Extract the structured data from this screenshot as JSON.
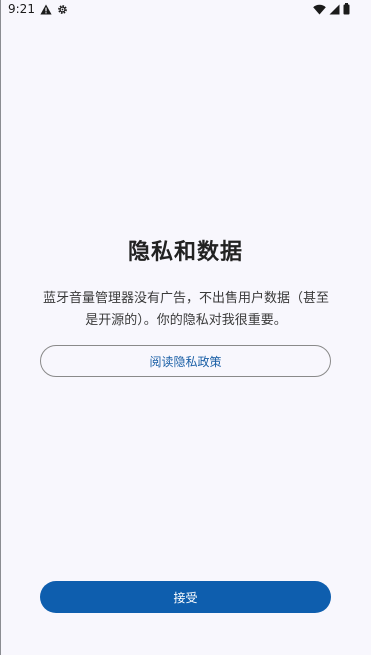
{
  "status_bar": {
    "time": "9:21",
    "left_icons": [
      "warning-icon",
      "settings-icon"
    ],
    "right_icons": [
      "wifi-icon",
      "signal-icon",
      "battery-icon"
    ]
  },
  "main": {
    "title": "隐私和数据",
    "description": "蓝牙音量管理器没有广告，不出售用户数据（甚至是开源的）。你的隐私对我很重要。",
    "privacy_button_label": "阅读隐私政策",
    "accept_button_label": "接受"
  },
  "colors": {
    "background": "#F8F7FD",
    "accent": "#0E5EAE",
    "link_text": "#1A5FA6"
  }
}
